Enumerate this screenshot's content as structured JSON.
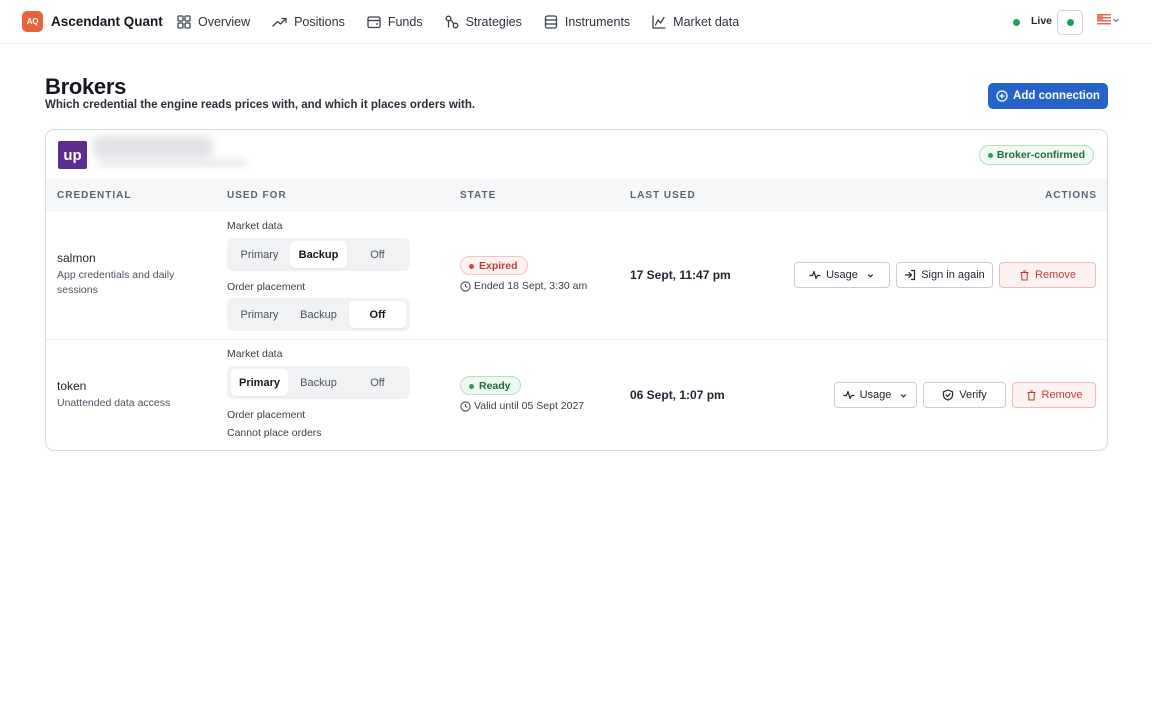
{
  "app": {
    "logo_text": "AQ",
    "name": "Ascendant Quant"
  },
  "nav": {
    "items": [
      {
        "label": "Overview",
        "icon": "grid-icon"
      },
      {
        "label": "Positions",
        "icon": "trend-icon"
      },
      {
        "label": "Funds",
        "icon": "wallet-icon"
      },
      {
        "label": "Strategies",
        "icon": "strategy-icon"
      },
      {
        "label": "Instruments",
        "icon": "database-icon"
      },
      {
        "label": "Market data",
        "icon": "chart-icon"
      }
    ],
    "live_label": "Live"
  },
  "page": {
    "title": "Brokers",
    "subtitle": "Which credential the engine reads prices with, and which it places orders with.",
    "add_button": "Add connection"
  },
  "broker": {
    "logo_text": "up",
    "badge": "Broker-confirmed",
    "columns": [
      "CREDENTIAL",
      "USED FOR",
      "STATE",
      "LAST USED",
      "ACTIONS"
    ],
    "rows": [
      {
        "name": "salmon",
        "description": "App credentials and daily sessions",
        "market_label": "Market data",
        "market_options": [
          "Primary",
          "Backup",
          "Off"
        ],
        "market_selected": "Backup",
        "order_label": "Order placement",
        "order_options": [
          "Primary",
          "Backup",
          "Off"
        ],
        "order_selected": "Off",
        "state": "Expired",
        "state_note": "Ended 18 Sept, 3:30 am",
        "last_used": "17 Sept, 11:47 pm",
        "actions": [
          "Usage",
          "Sign in again",
          "Remove"
        ]
      },
      {
        "name": "token",
        "description": "Unattended data access",
        "market_label": "Market data",
        "market_options": [
          "Primary",
          "Backup",
          "Off"
        ],
        "market_selected": "Primary",
        "order_label": "Order placement",
        "order_note": "Cannot place orders",
        "state": "Ready",
        "state_note": "Valid until 05 Sept 2027",
        "last_used": "06 Sept, 1:07 pm",
        "actions": [
          "Usage",
          "Verify",
          "Remove"
        ]
      }
    ]
  },
  "colors": {
    "accent": "#2563c9",
    "brand_logo": "#e8623a",
    "broker_logo": "#5b2d8e",
    "live": "#1aa05a",
    "danger": "#c23b3b",
    "success": "#1f6b3a"
  }
}
